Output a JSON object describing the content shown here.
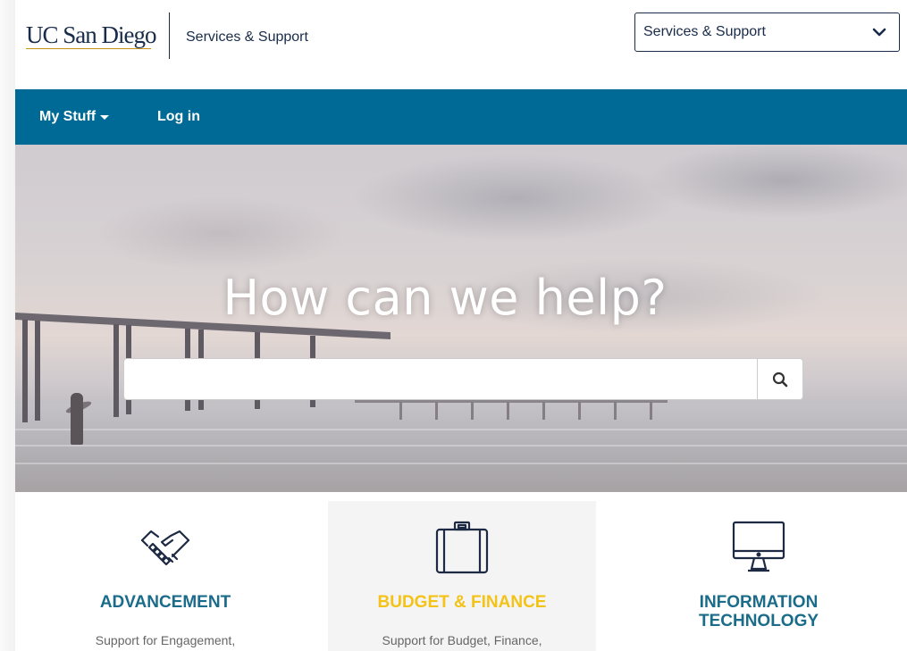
{
  "header": {
    "logo_text": "UC San Diego",
    "title": "Services & Support",
    "portal_select": {
      "value": "Services & Support"
    }
  },
  "nav": {
    "my_stuff": "My Stuff",
    "login": "Log in"
  },
  "hero": {
    "title": "How can we help?",
    "search_placeholder": ""
  },
  "cards": [
    {
      "title": "ADVANCEMENT",
      "description": "Support for Engagement,",
      "icon": "handshake-icon"
    },
    {
      "title": "BUDGET & FINANCE",
      "description": "Support for Budget, Finance,",
      "icon": "briefcase-icon"
    },
    {
      "title_line1": "INFORMATION",
      "title_line2": "TECHNOLOGY",
      "icon": "monitor-icon"
    }
  ],
  "colors": {
    "navy": "#182b49",
    "nav_blue": "#006a96",
    "card_title_blue": "#1a6c8a",
    "gold": "#f3c318"
  }
}
